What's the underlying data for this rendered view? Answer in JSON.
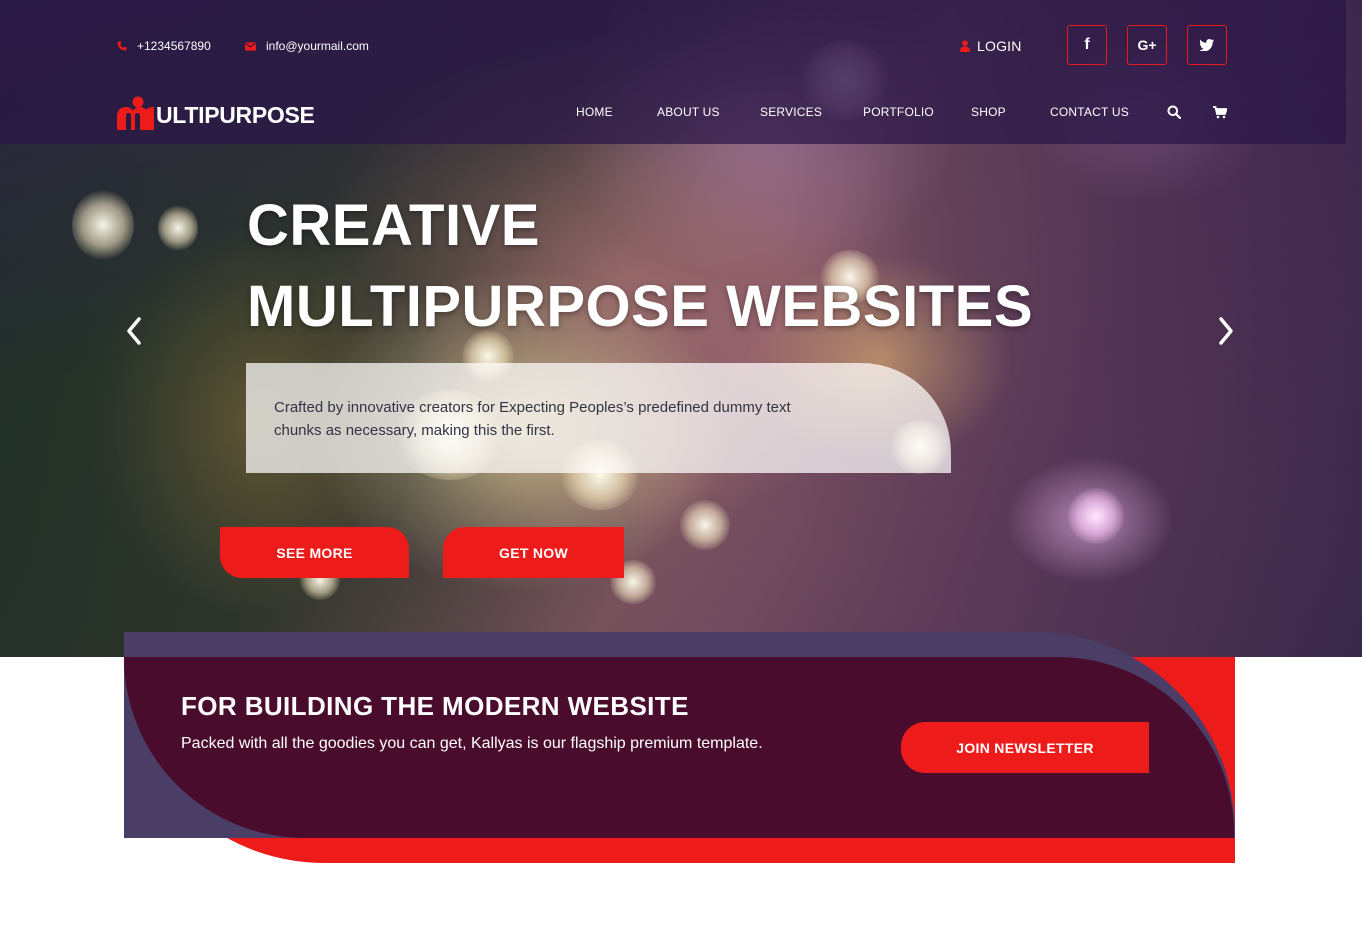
{
  "topbar": {
    "phone": "+1234567890",
    "email": "info@yourmail.com",
    "login_label": "LOGIN",
    "social_facebook": "f",
    "social_googleplus": "G+",
    "social_twitter_icon": "twitter-icon"
  },
  "brand": {
    "logo_text": "ULTIPURPOSE",
    "logo_icon": "m-logo-icon"
  },
  "nav": {
    "items": [
      {
        "label": "HOME"
      },
      {
        "label": "ABOUT US"
      },
      {
        "label": "SERVICES"
      },
      {
        "label": "PORTFOLIO"
      },
      {
        "label": "SHOP"
      },
      {
        "label": "CONTACT US"
      }
    ],
    "search_icon": "search-icon",
    "cart_icon": "cart-icon"
  },
  "hero": {
    "title_line1": "CREATIVE",
    "title_line2": "MULTIPURPOSE WEBSITES",
    "description": "Crafted by innovative creators for Expecting Peoples’s predefined dummy text chunks as necessary, making this the first.",
    "see_more_label": "SEE MORE",
    "get_now_label": "GET NOW",
    "prev_icon": "chevron-left-icon",
    "next_icon": "chevron-right-icon"
  },
  "newsletter": {
    "title": "FOR BUILDING THE MODERN WEBSITE",
    "subtitle": "Packed with all the goodies you can get, Kallyas is our flagship premium template.",
    "button_label": "JOIN NEWSLETTER"
  },
  "colors": {
    "accent_red": "#ee1b1b",
    "topbar_purple": "#2a1646",
    "band_maroon": "#4a0c2c",
    "band_lavender": "#4a3d66"
  }
}
